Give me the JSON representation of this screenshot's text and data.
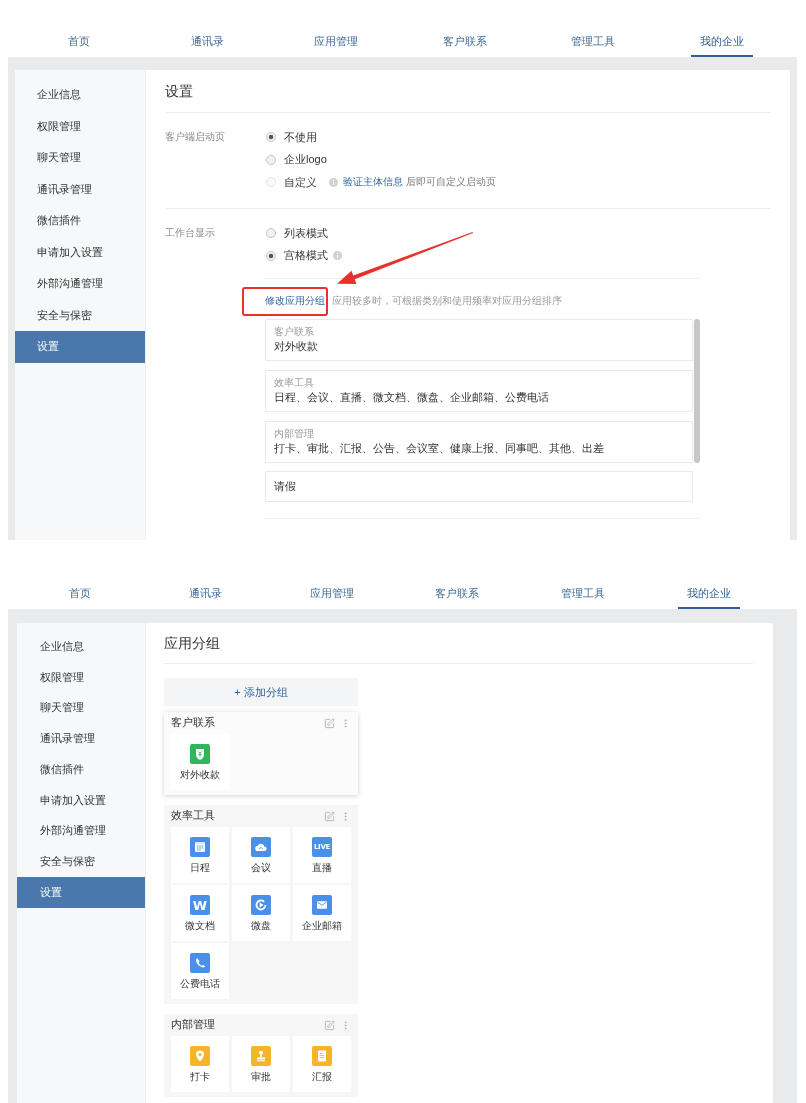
{
  "screens": [
    {
      "nav_tabs": [
        {
          "label": "首页",
          "selected": false
        },
        {
          "label": "通讯录",
          "selected": false
        },
        {
          "label": "应用管理",
          "selected": false
        },
        {
          "label": "客户联系",
          "selected": false
        },
        {
          "label": "管理工具",
          "selected": false
        },
        {
          "label": "我的企业",
          "selected": true
        }
      ],
      "sidebar": {
        "items": [
          {
            "label": "企业信息",
            "selected": false
          },
          {
            "label": "权限管理",
            "selected": false
          },
          {
            "label": "聊天管理",
            "selected": false
          },
          {
            "label": "通讯录管理",
            "selected": false
          },
          {
            "label": "微信插件",
            "selected": false
          },
          {
            "label": "申请加入设置",
            "selected": false
          },
          {
            "label": "外部沟通管理",
            "selected": false
          },
          {
            "label": "安全与保密",
            "selected": false
          },
          {
            "label": "设置",
            "selected": true
          }
        ]
      },
      "page": {
        "kind": "settings",
        "title": "设置",
        "settings": [
          {
            "label": "客户端启动页",
            "options": [
              {
                "label": "不使用",
                "selected": true,
                "disabled": false,
                "info": false
              },
              {
                "label": "企业logo",
                "selected": false,
                "disabled": false,
                "info": false
              },
              {
                "label": "自定义",
                "selected": false,
                "disabled": true,
                "info": true,
                "note_link": "验证主体信息",
                "note": "后即可自定义启动页"
              }
            ]
          },
          {
            "label": "工作台显示",
            "options": [
              {
                "label": "列表模式",
                "selected": false,
                "disabled": false,
                "info": false
              },
              {
                "label": "宫格模式",
                "selected": true,
                "disabled": false,
                "info": true
              }
            ],
            "group_editor": {
              "link": "修改应用分组",
              "hint": "应用较多时，可根据类别和使用频率对应用分组排序",
              "groups": [
                {
                  "title": "客户联系",
                  "apps": "对外收款"
                },
                {
                  "title": "效率工具",
                  "apps": "日程、会议、直播、微文档、微盘、企业邮箱、公费电话"
                },
                {
                  "title": "内部管理",
                  "apps": "打卡、审批、汇报、公告、会议室、健康上报、同事吧、其他、出差"
                },
                {
                  "apps": "请假"
                }
              ]
            }
          }
        ]
      }
    },
    {
      "nav_tabs": [
        {
          "label": "首页",
          "selected": false
        },
        {
          "label": "通讯录",
          "selected": false
        },
        {
          "label": "应用管理",
          "selected": false
        },
        {
          "label": "客户联系",
          "selected": false
        },
        {
          "label": "管理工具",
          "selected": false
        },
        {
          "label": "我的企业",
          "selected": true
        }
      ],
      "sidebar": {
        "items": [
          {
            "label": "企业信息",
            "selected": false
          },
          {
            "label": "权限管理",
            "selected": false
          },
          {
            "label": "聊天管理",
            "selected": false
          },
          {
            "label": "通讯录管理",
            "selected": false
          },
          {
            "label": "微信插件",
            "selected": false
          },
          {
            "label": "申请加入设置",
            "selected": false
          },
          {
            "label": "外部沟通管理",
            "selected": false
          },
          {
            "label": "安全与保密",
            "selected": false
          },
          {
            "label": "设置",
            "selected": true
          }
        ]
      },
      "page": {
        "kind": "app_groups",
        "title": "应用分组",
        "add_button": "+ 添加分组",
        "groups": [
          {
            "title": "客户联系",
            "raised": true,
            "apps": [
              {
                "name": "对外收款",
                "color": "#2fb55a"
              }
            ]
          },
          {
            "title": "效率工具",
            "raised": false,
            "apps": [
              {
                "name": "日程",
                "color": "#4a90e8"
              },
              {
                "name": "会议",
                "color": "#4a90e8"
              },
              {
                "name": "直播",
                "color": "#4a90e8",
                "logo_text": "LIVE"
              },
              {
                "name": "微文档",
                "color": "#4a90e8",
                "logo_text": "W"
              },
              {
                "name": "微盘",
                "color": "#4a90e8"
              },
              {
                "name": "企业邮箱",
                "color": "#4a90e8"
              },
              {
                "name": "公费电话",
                "color": "#4a90e8"
              }
            ]
          },
          {
            "title": "内部管理",
            "raised": false,
            "apps": [
              {
                "name": "打卡",
                "color": "#f6b428"
              },
              {
                "name": "审批",
                "color": "#f6b428"
              },
              {
                "name": "汇报",
                "color": "#f6b428"
              }
            ]
          }
        ]
      }
    }
  ]
}
